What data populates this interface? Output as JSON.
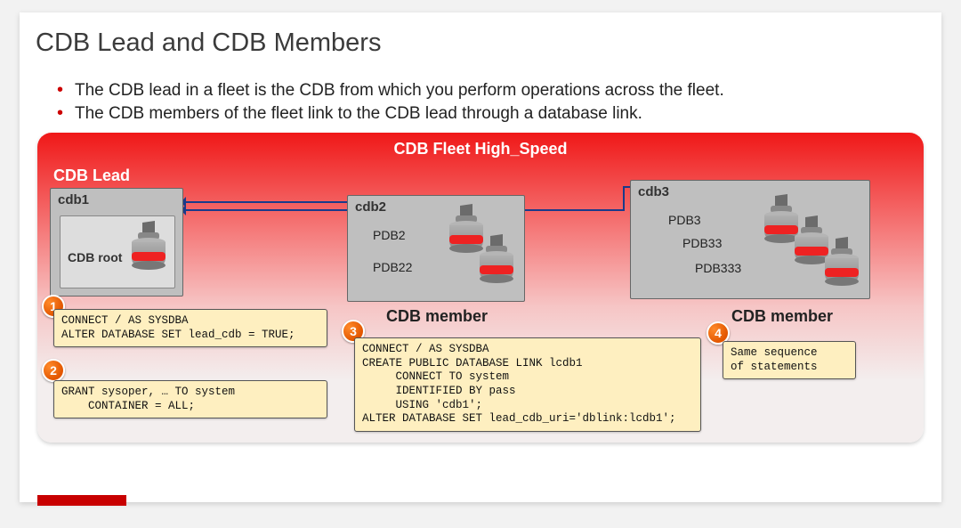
{
  "title": "CDB Lead and CDB Members",
  "bullets": [
    "The CDB lead in a fleet is the CDB from which you perform operations across the fleet.",
    "The CDB members of the fleet link to the CDB lead through a database link."
  ],
  "diagram": {
    "fleet_title": "CDB Fleet High_Speed",
    "lead_label": "CDB Lead",
    "member_label": "CDB member",
    "lead": {
      "name": "cdb1",
      "root": "CDB root"
    },
    "members": [
      {
        "name": "cdb2",
        "pdbs": [
          "PDB2",
          "PDB22"
        ]
      },
      {
        "name": "cdb3",
        "pdbs": [
          "PDB3",
          "PDB33",
          "PDB333"
        ]
      }
    ]
  },
  "code": {
    "c1": "CONNECT / AS SYSDBA\nALTER DATABASE SET lead_cdb = TRUE;",
    "c2": "GRANT sysoper, … TO system\n    CONTAINER = ALL;",
    "c3": "CONNECT / AS SYSDBA\nCREATE PUBLIC DATABASE LINK lcdb1\n     CONNECT TO system\n     IDENTIFIED BY pass\n     USING 'cdb1';\nALTER DATABASE SET lead_cdb_uri='dblink:lcdb1';",
    "c4": "Same sequence\nof statements"
  },
  "badges": {
    "b1": "1",
    "b2": "2",
    "b3": "3",
    "b4": "4"
  }
}
